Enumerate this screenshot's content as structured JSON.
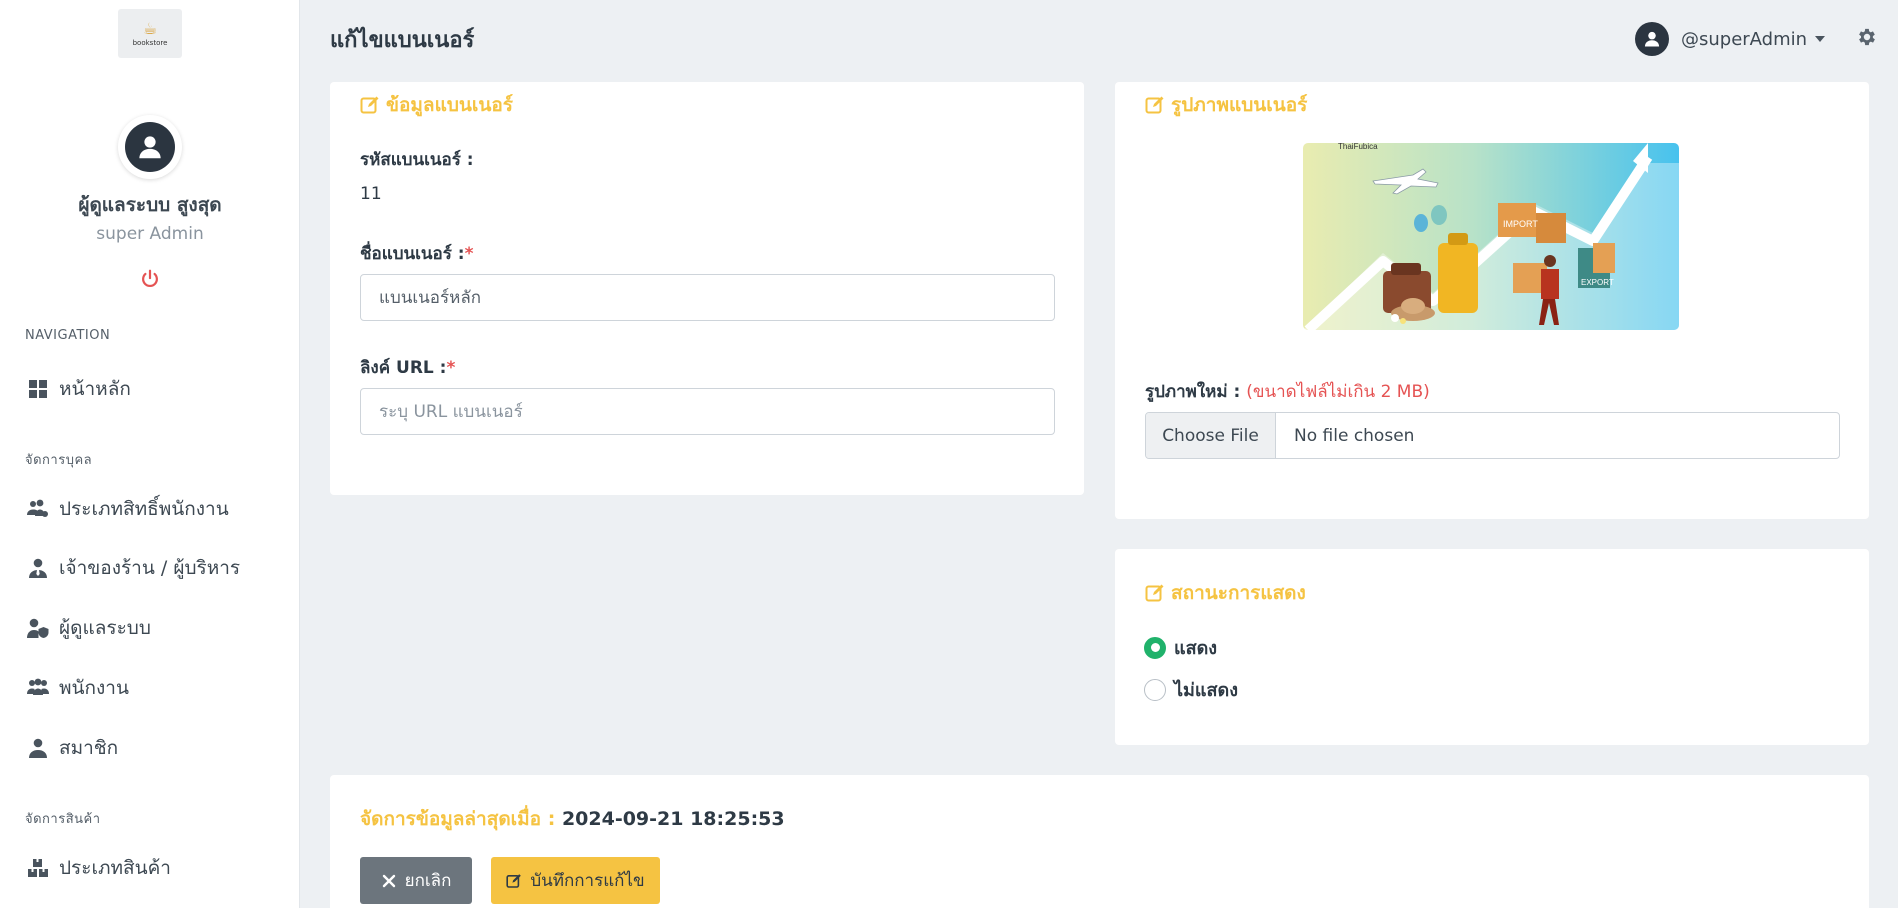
{
  "app": {
    "logo_text": "bookstore"
  },
  "header": {
    "title": "แก้ไขแบนเนอร์",
    "username": "@superAdmin"
  },
  "profile": {
    "name": "ผู้ดูแลระบบ สูงสุด",
    "role": "super Admin"
  },
  "sidebar": {
    "headings": {
      "navigation": "NAVIGATION",
      "people": "จัดการบุคล",
      "products": "จัดการสินค้า"
    },
    "items": [
      {
        "label": "หน้าหลัก",
        "icon": "dashboard-icon"
      },
      {
        "label": "ประเภทสิทธิ์พนักงาน",
        "icon": "users-cog-icon"
      },
      {
        "label": "เจ้าของร้าน / ผู้บริหาร",
        "icon": "user-tie-icon"
      },
      {
        "label": "ผู้ดูแลระบบ",
        "icon": "user-shield-icon"
      },
      {
        "label": "พนักงาน",
        "icon": "users-icon"
      },
      {
        "label": "สมาชิก",
        "icon": "user-icon"
      },
      {
        "label": "ประเภทสินค้า",
        "icon": "boxes-icon"
      }
    ]
  },
  "banner_info": {
    "title": "ข้อมูลแบนเนอร์",
    "code_label": "รหัสแบนเนอร์ :",
    "code_value": "11",
    "name_label": "ชื่อแบนเนอร์ :",
    "name_value": "แบนเนอร์หลัก",
    "url_label": "ลิงค์ URL :",
    "url_placeholder": "ระบุ URL แบนเนอร์",
    "required_mark": "*"
  },
  "banner_image": {
    "title": "รูปภาพแบนเนอร์",
    "image_caption": "ThaiFubica",
    "image_tags": [
      "IMPORT",
      "EXPORT"
    ],
    "new_image_label": "รูปภาพใหม่ :",
    "new_image_hint": "(ขนาดไฟล์ไม่เกิน 2 MB)",
    "choose_file": "Choose File",
    "no_file": "No file chosen"
  },
  "display_status": {
    "title": "สถานะการแสดง",
    "options": [
      {
        "label": "แสดง",
        "checked": true
      },
      {
        "label": "ไม่แสดง",
        "checked": false
      }
    ]
  },
  "footer": {
    "updated_label": "จัดการข้อมูลล่าสุดเมื่อ :",
    "updated_value": "2024-09-21 18:25:53",
    "cancel": "ยกเลิก",
    "save": "บันทึกการแก้ไข"
  },
  "colors": {
    "accent": "#f5c342",
    "danger": "#e55353",
    "success": "#20b26b",
    "secondary": "#6c757d"
  }
}
